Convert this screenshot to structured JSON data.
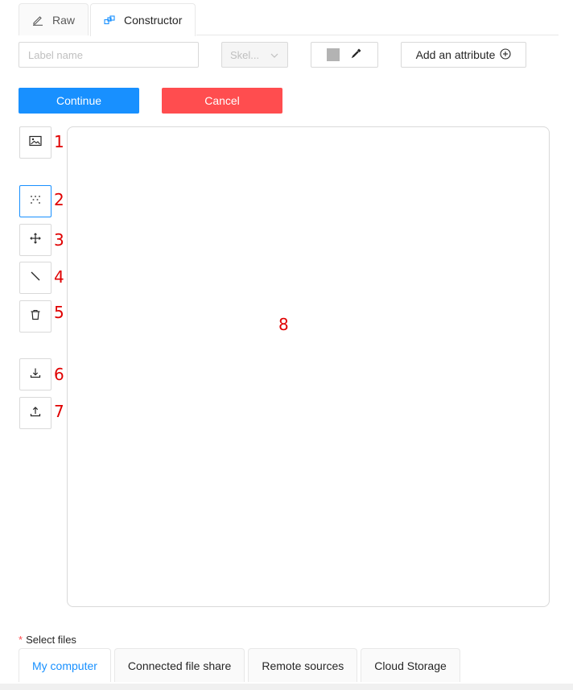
{
  "tabs": [
    {
      "label": "Raw",
      "icon": "pencil-icon",
      "active": false
    },
    {
      "label": "Constructor",
      "icon": "blocks-icon",
      "active": true
    }
  ],
  "form": {
    "label_placeholder": "Label name",
    "type_select_value": "Skel...",
    "color_swatch": "#b3b3b3",
    "add_attribute_label": "Add an attribute"
  },
  "actions": {
    "continue_label": "Continue",
    "cancel_label": "Cancel"
  },
  "tools": [
    {
      "icon": "image-icon",
      "marker": "1"
    },
    {
      "icon": "points-icon",
      "marker": "2",
      "active": true
    },
    {
      "icon": "move-icon",
      "marker": "3"
    },
    {
      "icon": "line-icon",
      "marker": "4"
    },
    {
      "icon": "trash-icon",
      "marker": "5"
    },
    {
      "icon": "download-icon",
      "marker": "6"
    },
    {
      "icon": "upload-icon",
      "marker": "7"
    }
  ],
  "canvas_marker": "8",
  "files": {
    "label": "Select files",
    "tabs": [
      "My computer",
      "Connected file share",
      "Remote sources",
      "Cloud Storage"
    ],
    "active_tab": "My computer"
  },
  "colors": {
    "primary": "#1890ff",
    "danger": "#ff4d4f",
    "marker": "#e00000"
  }
}
